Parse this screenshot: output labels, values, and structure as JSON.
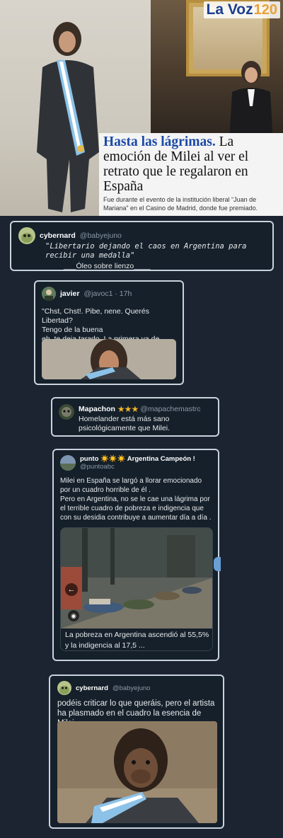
{
  "article": {
    "logo_text": "La Voz",
    "logo_number": "120",
    "title_bold": "Hasta las lágrimas.",
    "title_rest": " La emoción de Milei al ver el retrato que le regalaron en España",
    "subtitle": "Fue durante el evento de la institución liberal “Juan de Mariana” en el Casino de Madrid, donde fue premiado."
  },
  "tweets": [
    {
      "name": "cybernard",
      "handle": "@babyejuno",
      "text": "\"Libertario dejando el caos en Argentina para recibir una medalla\"",
      "caption": "___Óleo sobre lienzo____"
    },
    {
      "name": "javier",
      "handle": "@javoc1 · 17h",
      "text": "\"Chst, Chst!. Pibe, nene. Querés Libertad?\nTengo de la buena\neh, te deja tarado. La primera va de regalo \""
    },
    {
      "name": "Mapachon",
      "name_suffix": "★★★",
      "handle": "@mapachemastro",
      "text": "Homelander está más sano psicológicamente que Milei."
    },
    {
      "name": "punto ☀️☀️☀️ Argentina Campeón !",
      "handle": "@puntoabc",
      "text": "Milei en España se largó a llorar emocionado por un cuadro horrible de él .\nPero en Argentina, no se le cae una lágrima por el terrible cuadro de pobreza e indigencia  que con su desidia contribuye a aumentar  día a día .",
      "link_caption": "La pobreza en Argentina ascendió al 55,5% y la indigencia al 17,5 ..."
    },
    {
      "name": "cybernard",
      "handle": "@babyejuno",
      "text": "podéis criticar lo que queráis, pero el artista ha plasmado en el cuadro la esencia de Milei"
    }
  ],
  "colors": {
    "background": "#1c2431",
    "card": "#15202b",
    "card_border": "#c9d3de",
    "brand_blue": "#1b4aa6",
    "star": "#f0b429"
  },
  "icons": [
    "back-arrow-icon",
    "lens-search-icon"
  ]
}
